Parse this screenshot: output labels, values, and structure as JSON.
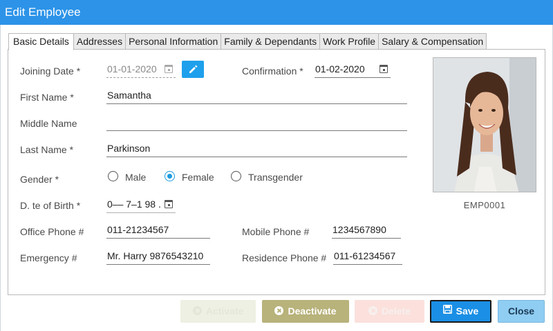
{
  "window": {
    "title": "Edit Employee"
  },
  "tabs": [
    {
      "label": "Basic Details",
      "active": true
    },
    {
      "label": "Addresses"
    },
    {
      "label": "Personal Information"
    },
    {
      "label": "Family & Dependants"
    },
    {
      "label": "Work Profile"
    },
    {
      "label": "Salary & Compensation"
    }
  ],
  "form": {
    "joining_date": {
      "label": "Joining Date *",
      "value": "01-01-2020"
    },
    "confirmation": {
      "label": "Confirmation *",
      "value": "01-02-2020"
    },
    "first_name": {
      "label": "First Name *",
      "value": "Samantha"
    },
    "middle_name": {
      "label": "Middle Name",
      "value": ""
    },
    "last_name": {
      "label": "Last Name *",
      "value": "Parkinson"
    },
    "gender": {
      "label": "Gender *",
      "options": [
        "Male",
        "Female",
        "Transgender"
      ],
      "selected": "Female"
    },
    "date_of_birth": {
      "label": "D. te of Birth *",
      "value": "0–– 7–1 98 ."
    },
    "office_phone": {
      "label": "Office Phone #",
      "value": "011-21234567"
    },
    "mobile_phone": {
      "label": "Mobile Phone #",
      "value": "1234567890"
    },
    "emergency": {
      "label": "Emergency #",
      "value": "Mr. Harry 9876543210"
    },
    "residence_phone": {
      "label": "Residence Phone #",
      "value": "011-61234567"
    }
  },
  "employee_id": "EMP0001",
  "buttons": {
    "activate": "Activate",
    "deactivate": "Deactivate",
    "delete": "Delete",
    "save": "Save",
    "close": "Close"
  },
  "colors": {
    "titlebar": "#2c93e8",
    "accent": "#1fa0ec",
    "deactivate": "#b8b27b",
    "save": "#1b8fe5",
    "close": "#8fcdf2"
  }
}
